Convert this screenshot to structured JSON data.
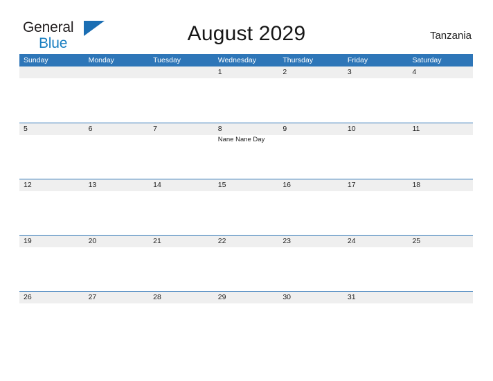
{
  "brand": {
    "name_top": "General",
    "name_bottom": "Blue",
    "triangle_color": "#1b6eb3",
    "blue_text_color": "#1a7fc1"
  },
  "header": {
    "title": "August 2029",
    "country": "Tanzania"
  },
  "theme": {
    "header_blue": "#2e76b8",
    "row_stripe": "#efefef",
    "page_background": "#ffffff",
    "text": "#1d1d1d"
  },
  "calendar": {
    "weekdays": [
      "Sunday",
      "Monday",
      "Tuesday",
      "Wednesday",
      "Thursday",
      "Friday",
      "Saturday"
    ],
    "weeks": [
      [
        {
          "day": "",
          "event": ""
        },
        {
          "day": "",
          "event": ""
        },
        {
          "day": "",
          "event": ""
        },
        {
          "day": "1",
          "event": ""
        },
        {
          "day": "2",
          "event": ""
        },
        {
          "day": "3",
          "event": ""
        },
        {
          "day": "4",
          "event": ""
        }
      ],
      [
        {
          "day": "5",
          "event": ""
        },
        {
          "day": "6",
          "event": ""
        },
        {
          "day": "7",
          "event": ""
        },
        {
          "day": "8",
          "event": "Nane Nane Day"
        },
        {
          "day": "9",
          "event": ""
        },
        {
          "day": "10",
          "event": ""
        },
        {
          "day": "11",
          "event": ""
        }
      ],
      [
        {
          "day": "12",
          "event": ""
        },
        {
          "day": "13",
          "event": ""
        },
        {
          "day": "14",
          "event": ""
        },
        {
          "day": "15",
          "event": ""
        },
        {
          "day": "16",
          "event": ""
        },
        {
          "day": "17",
          "event": ""
        },
        {
          "day": "18",
          "event": ""
        }
      ],
      [
        {
          "day": "19",
          "event": ""
        },
        {
          "day": "20",
          "event": ""
        },
        {
          "day": "21",
          "event": ""
        },
        {
          "day": "22",
          "event": ""
        },
        {
          "day": "23",
          "event": ""
        },
        {
          "day": "24",
          "event": ""
        },
        {
          "day": "25",
          "event": ""
        }
      ],
      [
        {
          "day": "26",
          "event": ""
        },
        {
          "day": "27",
          "event": ""
        },
        {
          "day": "28",
          "event": ""
        },
        {
          "day": "29",
          "event": ""
        },
        {
          "day": "30",
          "event": ""
        },
        {
          "day": "31",
          "event": ""
        },
        {
          "day": "",
          "event": ""
        }
      ]
    ]
  }
}
